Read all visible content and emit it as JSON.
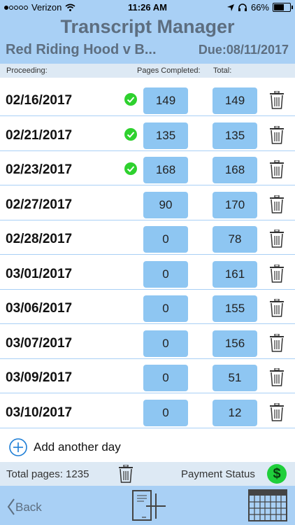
{
  "status_bar": {
    "carrier": "Verizon",
    "time": "11:26 AM",
    "battery": "66%",
    "signal_icons": [
      "location-arrow-icon",
      "headphones-icon"
    ]
  },
  "header": {
    "app_title": "Transcript Manager",
    "case_name": "Red Riding Hood v B...",
    "due_date": "Due:08/11/2017"
  },
  "columns": {
    "proceeding": "Proceeding:",
    "pages_completed": "Pages Completed:",
    "total": "Total:"
  },
  "rows": [
    {
      "date": "02/16/2017",
      "completed": true,
      "pages": "149",
      "total": "149"
    },
    {
      "date": "02/21/2017",
      "completed": true,
      "pages": "135",
      "total": "135"
    },
    {
      "date": "02/23/2017",
      "completed": true,
      "pages": "168",
      "total": "168"
    },
    {
      "date": "02/27/2017",
      "completed": false,
      "pages": "90",
      "total": "170"
    },
    {
      "date": "02/28/2017",
      "completed": false,
      "pages": "0",
      "total": "78"
    },
    {
      "date": "03/01/2017",
      "completed": false,
      "pages": "0",
      "total": "161"
    },
    {
      "date": "03/06/2017",
      "completed": false,
      "pages": "0",
      "total": "155"
    },
    {
      "date": "03/07/2017",
      "completed": false,
      "pages": "0",
      "total": "156"
    },
    {
      "date": "03/09/2017",
      "completed": false,
      "pages": "0",
      "total": "51"
    },
    {
      "date": "03/10/2017",
      "completed": false,
      "pages": "0",
      "total": "12"
    }
  ],
  "add_day": {
    "label": "Add another day"
  },
  "footer": {
    "total_pages": "Total pages: 1235",
    "payment_status": "Payment Status",
    "payment_symbol": "$"
  },
  "bottom_bar": {
    "back_label": "Back"
  },
  "colors": {
    "header_bg": "#a9d0f5",
    "title_text": "#5d6e80",
    "cell_bg": "#8ec6f2",
    "check_green": "#2ed12e",
    "add_blue": "#1e7ed6"
  }
}
